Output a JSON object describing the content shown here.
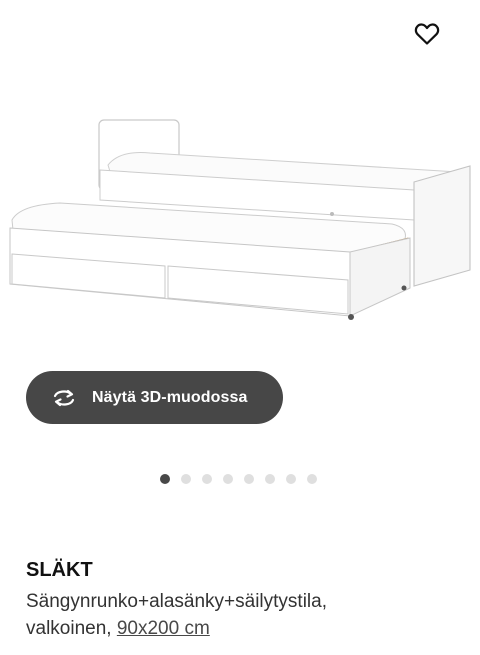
{
  "product": {
    "view_3d_label": "Näytä 3D-muodossa",
    "name": "SLÄKT",
    "description": "Sängynrunko+alasänky+säilytystila,",
    "color": "valkoinen,",
    "size_link": "90x200 cm"
  },
  "carousel": {
    "count": 8,
    "active_index": 0
  },
  "icons": {
    "favorite": "heart-icon",
    "view3d": "rotate-3d-icon"
  },
  "colors": {
    "button_bg": "#474747",
    "dot_active": "#484848",
    "dot_inactive": "#dfdfdf"
  }
}
